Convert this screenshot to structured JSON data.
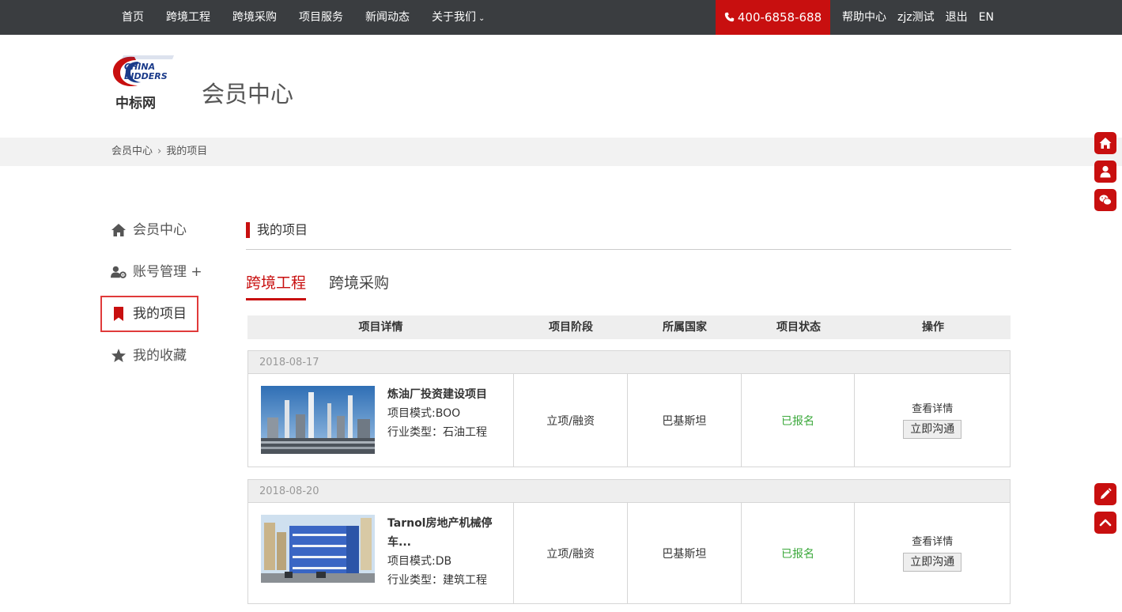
{
  "topnav": {
    "items": [
      "首页",
      "跨境工程",
      "跨境采购",
      "项目服务",
      "新闻动态",
      "关于我们"
    ],
    "phone": "400-6858-688",
    "right": [
      "帮助中心",
      "zjz测试",
      "退出",
      "EN"
    ]
  },
  "logo": {
    "en_line1": "CHINA",
    "en_line2": "BIDDERS",
    "cn": "中标网"
  },
  "header": {
    "title": "会员中心"
  },
  "breadcrumb": {
    "home": "会员中心",
    "sep": "›",
    "current": "我的项目"
  },
  "sidebar": {
    "items": [
      {
        "label": "会员中心",
        "icon": "home-icon"
      },
      {
        "label": "账号管理 +",
        "icon": "user-gear-icon"
      },
      {
        "label": "我的项目",
        "icon": "bookmark-icon",
        "active": true
      },
      {
        "label": "我的收藏",
        "icon": "star-icon"
      }
    ]
  },
  "section": {
    "title": "我的项目"
  },
  "tabs": [
    {
      "label": "跨境工程",
      "active": true
    },
    {
      "label": "跨境采购",
      "active": false
    }
  ],
  "table": {
    "headers": [
      "项目详情",
      "项目阶段",
      "所属国家",
      "项目状态",
      "操作"
    ],
    "rows": [
      {
        "date": "2018-08-17",
        "name": "炼油厂投资建设项目",
        "mode": "项目模式:BOO",
        "industry": "行业类型：石油工程",
        "stage": "立项/融资",
        "country": "巴基斯坦",
        "status": "已报名",
        "view": "查看详情",
        "contact": "立即沟通"
      },
      {
        "date": "2018-08-20",
        "name": "Tarnol房地产机械停车...",
        "mode": "项目模式:DB",
        "industry": "行业类型：建筑工程",
        "stage": "立项/融资",
        "country": "巴基斯坦",
        "status": "已报名",
        "view": "查看详情",
        "contact": "立即沟通"
      }
    ]
  },
  "colors": {
    "brand_red": "#c80f0f",
    "status_green": "#3aa83a",
    "topbar": "#3a3d40"
  }
}
